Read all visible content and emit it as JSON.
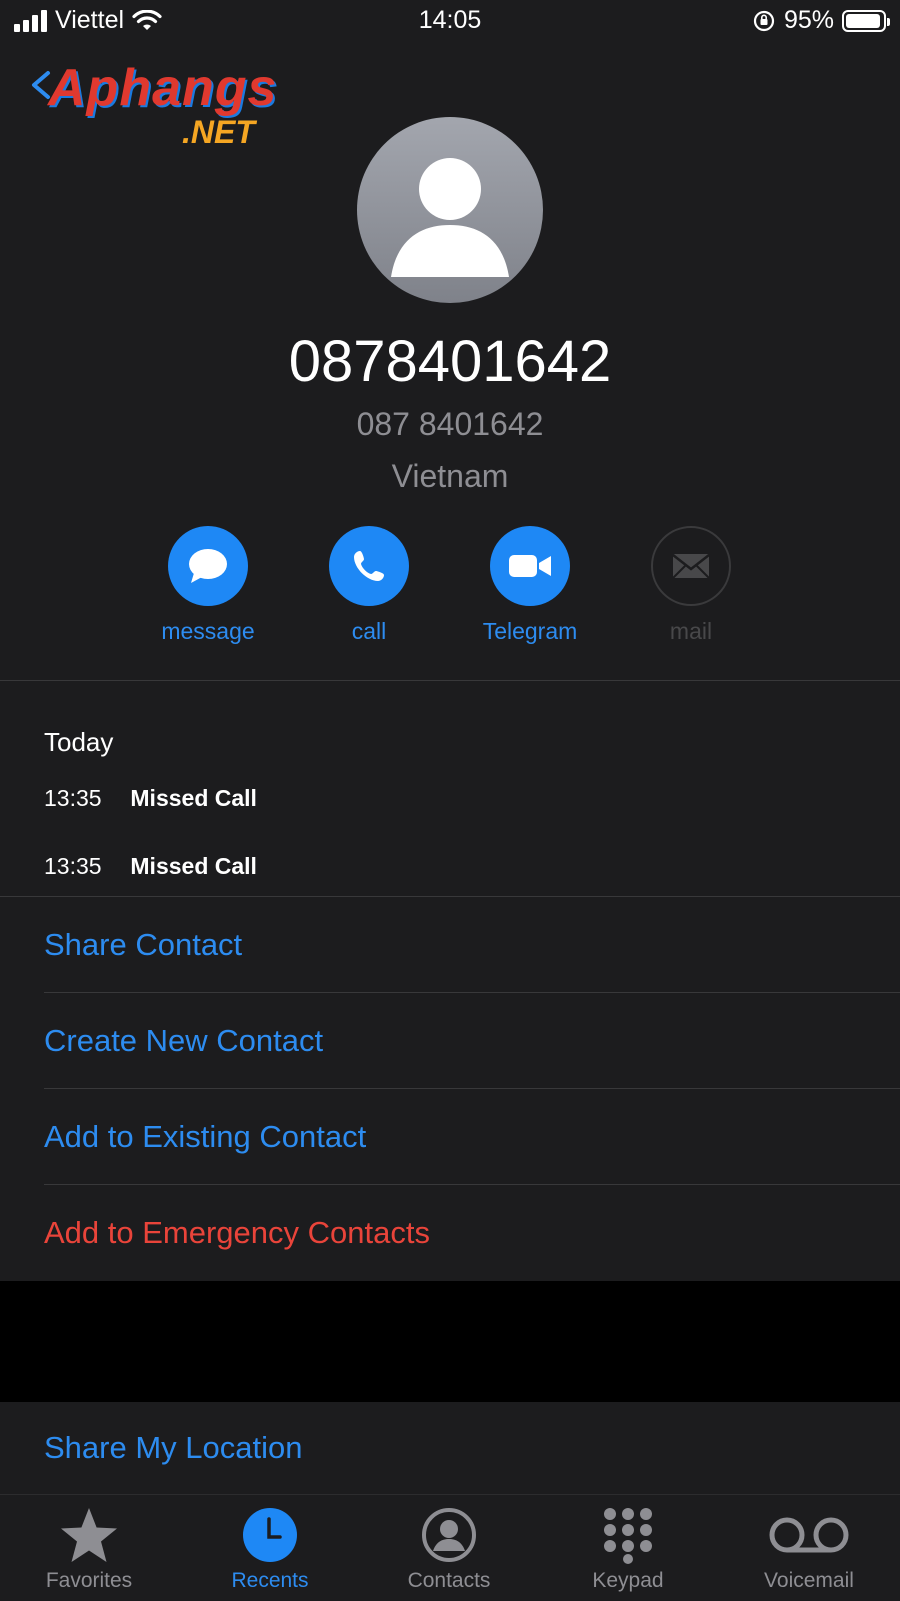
{
  "status_bar": {
    "carrier": "Viettel",
    "time": "14:05",
    "battery": "95%",
    "battery_level": 0.95
  },
  "watermark": {
    "brand": "Aphangs",
    "suffix": ".NET"
  },
  "contact": {
    "number": "0878401642",
    "formatted_number": "087 8401642",
    "country": "Vietnam"
  },
  "actions": [
    {
      "label": "message",
      "icon": "message-bubble-icon",
      "enabled": true
    },
    {
      "label": "call",
      "icon": "phone-icon",
      "enabled": true
    },
    {
      "label": "Telegram",
      "icon": "video-camera-icon",
      "enabled": true
    },
    {
      "label": "mail",
      "icon": "envelope-icon",
      "enabled": false
    }
  ],
  "recents": {
    "heading": "Today",
    "calls": [
      {
        "time": "13:35",
        "status": "Missed Call"
      },
      {
        "time": "13:35",
        "status": "Missed Call"
      }
    ]
  },
  "options": {
    "share_contact": "Share Contact",
    "create_new": "Create New Contact",
    "add_existing": "Add to Existing Contact",
    "add_emergency": "Add to Emergency Contacts",
    "share_location": "Share My Location"
  },
  "tabbar": [
    {
      "label": "Favorites",
      "icon": "star-icon",
      "active": false
    },
    {
      "label": "Recents",
      "icon": "clock-icon",
      "active": true
    },
    {
      "label": "Contacts",
      "icon": "person-circle-icon",
      "active": false
    },
    {
      "label": "Keypad",
      "icon": "keypad-icon",
      "active": false
    },
    {
      "label": "Voicemail",
      "icon": "voicemail-icon",
      "active": false
    }
  ],
  "colors": {
    "accent": "#2d8cf0",
    "action_fill": "#1e88f5",
    "danger": "#e9443a",
    "panel": "#1c1c1e",
    "secondary_text": "#8e8e93"
  }
}
